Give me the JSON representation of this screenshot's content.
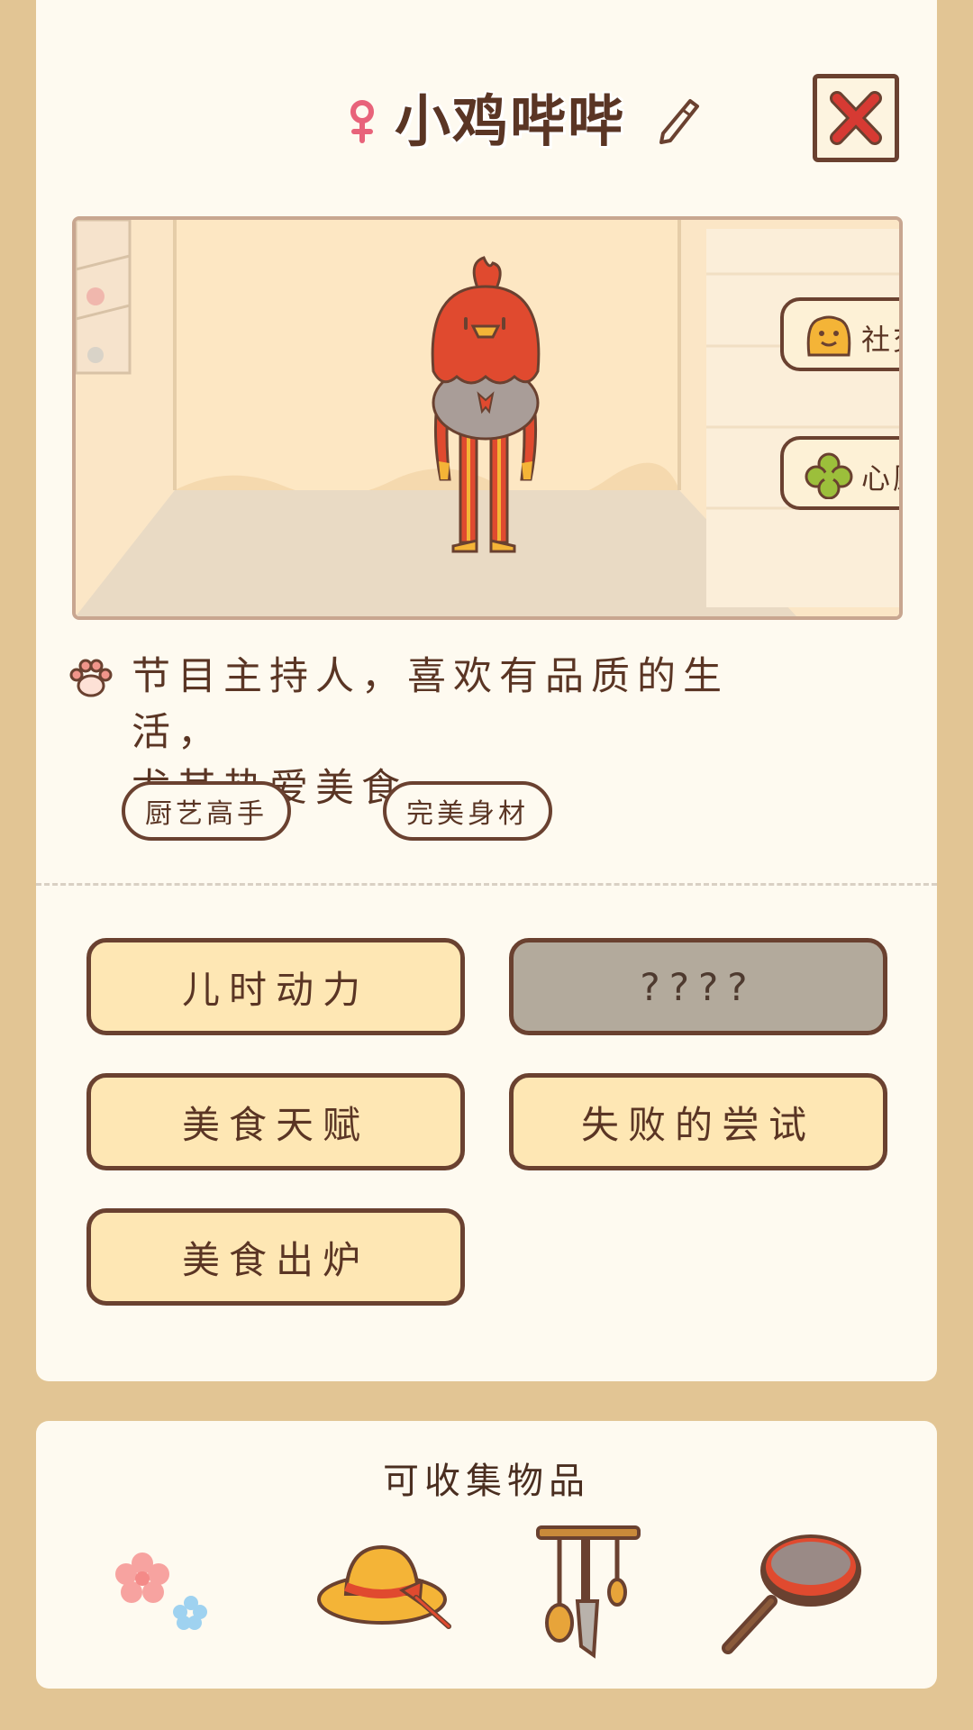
{
  "header": {
    "name": "小鸡哔哔",
    "close_label": "✕"
  },
  "scene": {
    "side_buttons": [
      {
        "label": "社交",
        "icon": "social-icon"
      },
      {
        "label": "心愿",
        "icon": "clover-icon"
      }
    ]
  },
  "profile": {
    "description_line1": "节目主持人，喜欢有品质的生活，",
    "description_line2": "尤其热爱美食。",
    "tags": [
      "厨艺高手",
      "完美身材"
    ]
  },
  "stories": [
    {
      "label": "儿时动力",
      "locked": false
    },
    {
      "label": "????",
      "locked": true
    },
    {
      "label": "美食天赋",
      "locked": false
    },
    {
      "label": "失败的尝试",
      "locked": false
    },
    {
      "label": "美食出炉",
      "locked": false
    }
  ],
  "collectibles": {
    "title": "可收集物品",
    "items": [
      "flowers-icon",
      "straw-hat-icon",
      "kitchen-utensils-icon",
      "frying-pan-icon"
    ]
  },
  "colors": {
    "background": "#e2c594",
    "card": "#fefaf0",
    "border": "#6a4130",
    "button": "#fee7b4",
    "locked_button": "#b3aa9c",
    "close_x": "#d63a33",
    "gender": "#e8637a"
  }
}
